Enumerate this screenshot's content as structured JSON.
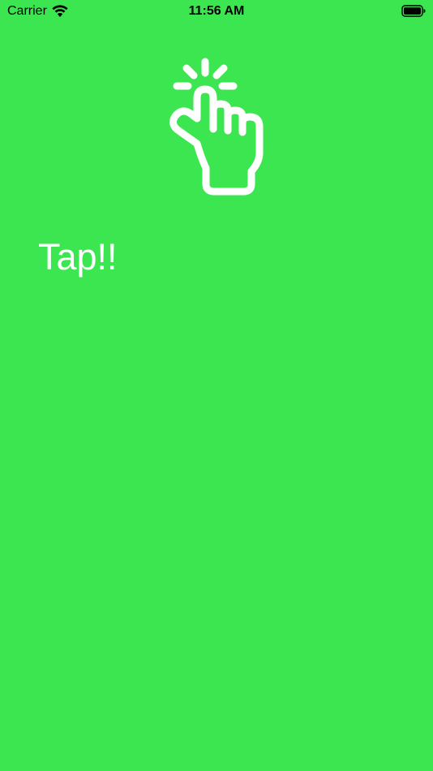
{
  "status_bar": {
    "carrier": "Carrier",
    "time": "11:56 AM",
    "wifi_icon": "wifi-icon",
    "battery_icon": "battery-icon"
  },
  "main": {
    "icon": "tap-hand-icon",
    "label": "Tap!!",
    "background_color": "#3be650",
    "foreground_color": "#ffffff"
  }
}
